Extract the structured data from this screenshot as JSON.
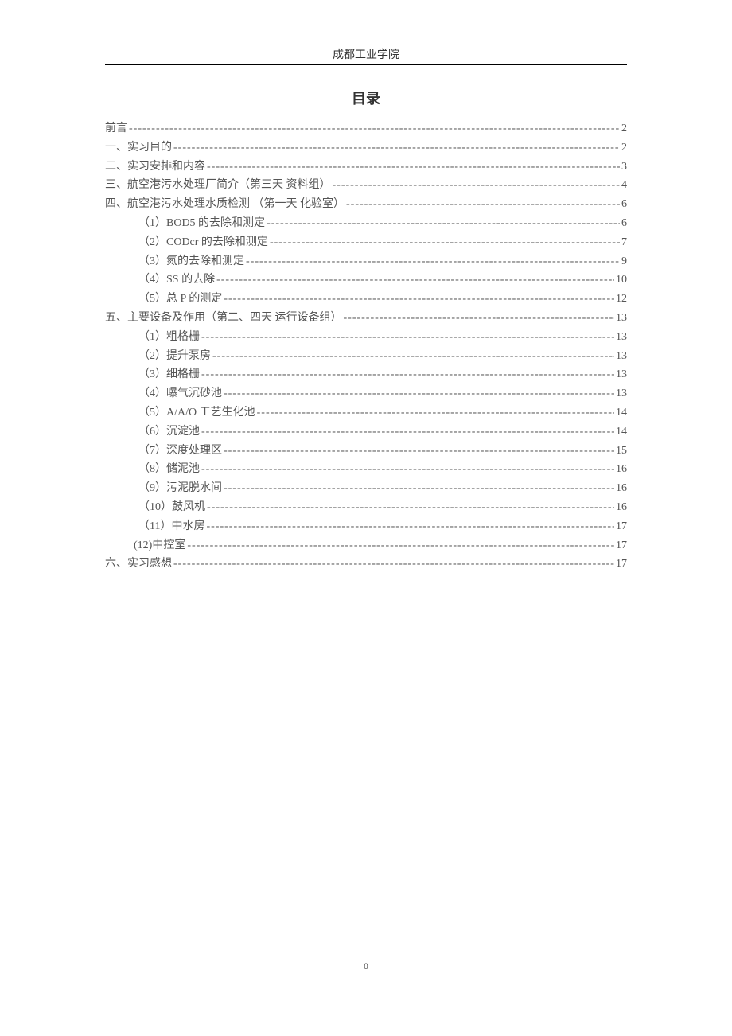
{
  "header": "成都工业学院",
  "title": "目录",
  "toc": [
    {
      "label": "前言",
      "page": "2",
      "indent": 0
    },
    {
      "label": "一、实习目的",
      "page": "2",
      "indent": 0
    },
    {
      "label": "二、实习安排和内容",
      "page": "3",
      "indent": 0
    },
    {
      "label": "三、航空港污水处理厂简介（第三天 资料组）",
      "page": "4",
      "indent": 0
    },
    {
      "label": "四、航空港污水处理水质检测 （第一天 化验室）",
      "page": "6",
      "indent": 0
    },
    {
      "label": "（1）BOD5 的去除和测定",
      "page": "6",
      "indent": 1
    },
    {
      "label": "（2）CODcr 的去除和测定",
      "page": "7",
      "indent": 1
    },
    {
      "label": "（3）氮的去除和测定",
      "page": "9",
      "indent": 1
    },
    {
      "label": "（4）SS 的去除",
      "page": "10",
      "indent": 1
    },
    {
      "label": "（5）总 P 的测定",
      "page": "12",
      "indent": 1
    },
    {
      "label": "五、主要设备及作用（第二、四天 运行设备组）",
      "page": "13",
      "indent": 0
    },
    {
      "label": "（1）粗格栅",
      "page": "13",
      "indent": 1
    },
    {
      "label": "（2）提升泵房",
      "page": "13",
      "indent": 1
    },
    {
      "label": "（3）细格栅",
      "page": "13",
      "indent": 1
    },
    {
      "label": "（4）曝气沉砂池",
      "page": "13",
      "indent": 1
    },
    {
      "label": "（5）A/A/O 工艺生化池",
      "page": "14",
      "indent": 1
    },
    {
      "label": "（6）沉淀池",
      "page": "14",
      "indent": 1
    },
    {
      "label": "（7）深度处理区",
      "page": "15",
      "indent": 1
    },
    {
      "label": "（8）储泥池",
      "page": "16",
      "indent": 1
    },
    {
      "label": "（9）污泥脱水间",
      "page": "16",
      "indent": 1
    },
    {
      "label": "（10）鼓风机",
      "page": "16",
      "indent": 1
    },
    {
      "label": "（11）中水房",
      "page": "17",
      "indent": 1
    },
    {
      "label": "(12)中控室",
      "page": "17",
      "indent": 2
    },
    {
      "label": "六、实习感想",
      "page": "17",
      "indent": 0
    }
  ],
  "footer_page_number": "0"
}
